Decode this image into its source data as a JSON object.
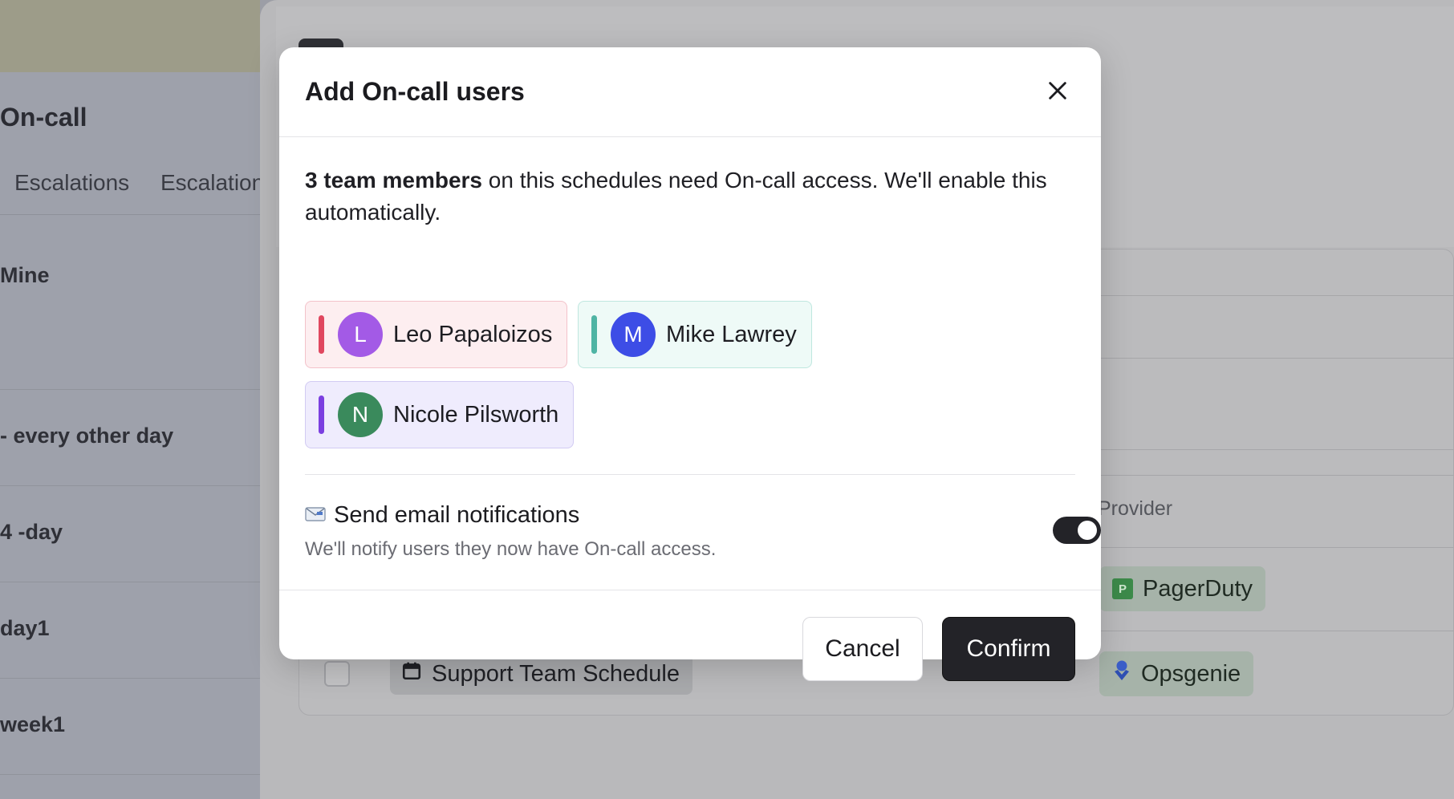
{
  "background": {
    "page_title": "On-call",
    "tabs": [
      "Escalations",
      "Escalation"
    ],
    "list_items": [
      "Mine",
      "- every other day",
      "4 -day",
      "day1",
      "week1"
    ],
    "provider_header": "Provider",
    "schedule_row": {
      "name": "Support Team Schedule"
    },
    "providers": [
      {
        "name": "PagerDuty",
        "logo_letter": "P",
        "icon": "pagerduty-logo-icon"
      },
      {
        "name": "Opsgenie",
        "icon": "opsgenie-logo-icon"
      }
    ]
  },
  "modal": {
    "title": "Add On-call users",
    "intro_bold": "3 team members",
    "intro_rest": " on this schedules need On-call access. We'll enable this automatically.",
    "users": [
      {
        "name": "Leo Papaloizos",
        "initial": "L",
        "bar_color": "#e0475f",
        "avatar_color": "#a35ae6",
        "chip_bg": "#fdeef0",
        "chip_border": "#f3c2ca"
      },
      {
        "name": "Mike Lawrey",
        "initial": "M",
        "bar_color": "#4fb4a4",
        "avatar_color": "#3d4de6",
        "chip_bg": "#eefaf7",
        "chip_border": "#bfe7df"
      },
      {
        "name": "Nicole Pilsworth",
        "initial": "N",
        "bar_color": "#7b3fe0",
        "avatar_color": "#3a8a5c",
        "chip_bg": "#efecfd",
        "chip_border": "#d2cbf3"
      }
    ],
    "notification": {
      "icon": "envelope-icon",
      "title": "Send email notifications",
      "subtitle": "We'll notify users they now have On-call access.",
      "enabled": true
    },
    "cancel_label": "Cancel",
    "confirm_label": "Confirm"
  }
}
